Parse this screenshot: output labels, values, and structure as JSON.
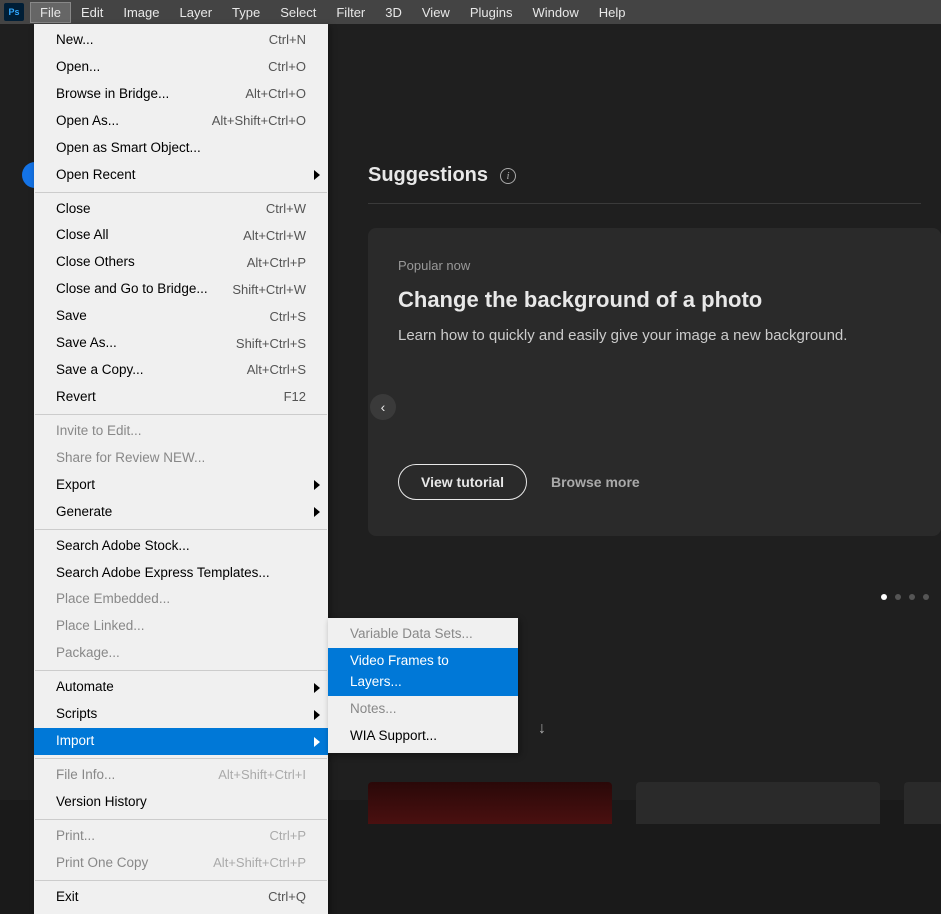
{
  "app": {
    "icon_label": "Ps"
  },
  "menubar": [
    "File",
    "Edit",
    "Image",
    "Layer",
    "Type",
    "Select",
    "Filter",
    "3D",
    "View",
    "Plugins",
    "Window",
    "Help"
  ],
  "active_menu_index": 0,
  "file_menu": {
    "groups": [
      [
        {
          "label": "New...",
          "shortcut": "Ctrl+N"
        },
        {
          "label": "Open...",
          "shortcut": "Ctrl+O"
        },
        {
          "label": "Browse in Bridge...",
          "shortcut": "Alt+Ctrl+O"
        },
        {
          "label": "Open As...",
          "shortcut": "Alt+Shift+Ctrl+O"
        },
        {
          "label": "Open as Smart Object..."
        },
        {
          "label": "Open Recent",
          "submenu": true
        }
      ],
      [
        {
          "label": "Close",
          "shortcut": "Ctrl+W"
        },
        {
          "label": "Close All",
          "shortcut": "Alt+Ctrl+W"
        },
        {
          "label": "Close Others",
          "shortcut": "Alt+Ctrl+P"
        },
        {
          "label": "Close and Go to Bridge...",
          "shortcut": "Shift+Ctrl+W"
        },
        {
          "label": "Save",
          "shortcut": "Ctrl+S"
        },
        {
          "label": "Save As...",
          "shortcut": "Shift+Ctrl+S"
        },
        {
          "label": "Save a Copy...",
          "shortcut": "Alt+Ctrl+S"
        },
        {
          "label": "Revert",
          "shortcut": "F12"
        }
      ],
      [
        {
          "label": "Invite to Edit...",
          "disabled": true
        },
        {
          "label": "Share for Review NEW...",
          "disabled": true
        },
        {
          "label": "Export",
          "submenu": true
        },
        {
          "label": "Generate",
          "submenu": true
        }
      ],
      [
        {
          "label": "Search Adobe Stock..."
        },
        {
          "label": "Search Adobe Express Templates..."
        },
        {
          "label": "Place Embedded...",
          "disabled": true
        },
        {
          "label": "Place Linked...",
          "disabled": true
        },
        {
          "label": "Package...",
          "disabled": true
        }
      ],
      [
        {
          "label": "Automate",
          "submenu": true
        },
        {
          "label": "Scripts",
          "submenu": true
        },
        {
          "label": "Import",
          "submenu": true,
          "highlighted": true
        }
      ],
      [
        {
          "label": "File Info...",
          "shortcut": "Alt+Shift+Ctrl+I",
          "disabled": true
        },
        {
          "label": "Version History"
        }
      ],
      [
        {
          "label": "Print...",
          "shortcut": "Ctrl+P",
          "disabled": true
        },
        {
          "label": "Print One Copy",
          "shortcut": "Alt+Shift+Ctrl+P",
          "disabled": true
        }
      ],
      [
        {
          "label": "Exit",
          "shortcut": "Ctrl+Q"
        }
      ]
    ]
  },
  "import_submenu": [
    {
      "label": "Variable Data Sets...",
      "disabled": true
    },
    {
      "label": "Video Frames to Layers...",
      "highlighted": true
    },
    {
      "label": "Notes...",
      "disabled": true
    },
    {
      "label": "WIA Support..."
    }
  ],
  "home": {
    "section_title": "Suggestions",
    "card": {
      "tag": "Popular now",
      "title": "Change the background of a photo",
      "description": "Learn how to quickly and easily give your image a new background.",
      "primary_button": "View tutorial",
      "secondary_link": "Browse more"
    }
  }
}
